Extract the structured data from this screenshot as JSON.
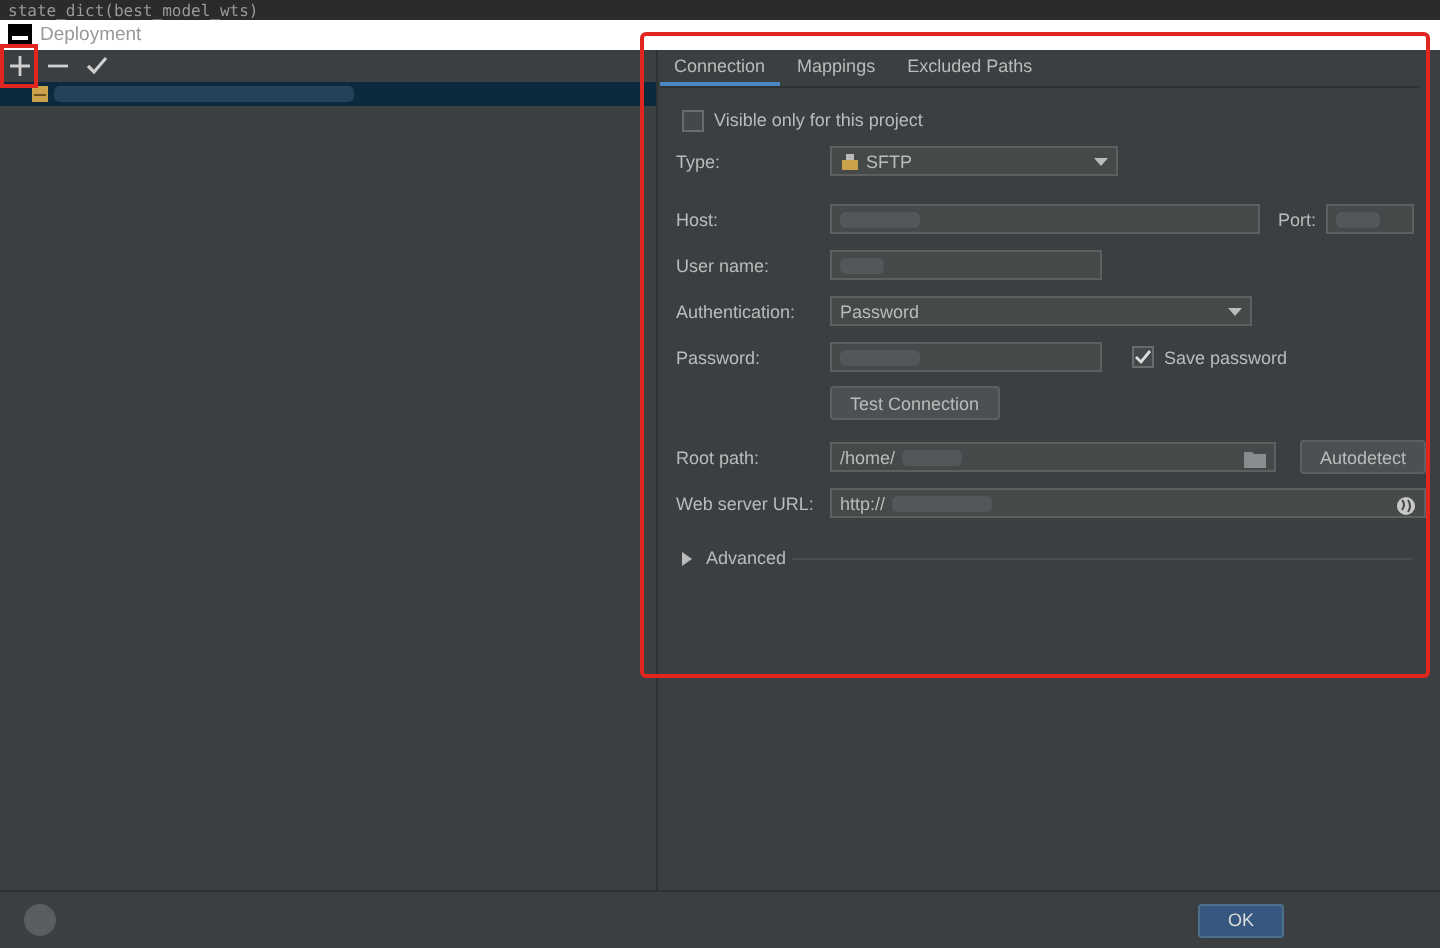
{
  "background_code": "state_dict(best_model_wts)",
  "window": {
    "title": "Deployment"
  },
  "toolbar": [
    {
      "kind": "plus"
    },
    {
      "kind": "minus"
    },
    {
      "kind": "check"
    }
  ],
  "servers": [
    {
      "selected": true
    }
  ],
  "tabs": [
    {
      "label": "Connection",
      "selected": true
    },
    {
      "label": "Mappings",
      "selected": false
    },
    {
      "label": "Excluded Paths",
      "selected": false
    }
  ],
  "visible_only": {
    "label": "Visible only for this project",
    "checked": false
  },
  "type": {
    "label": "Type:",
    "value": "SFTP"
  },
  "host": {
    "label": "Host:"
  },
  "port": {
    "label": "Port:"
  },
  "user_name": {
    "label": "User name:"
  },
  "authentication": {
    "label": "Authentication:",
    "value": "Password"
  },
  "password": {
    "label": "Password:"
  },
  "save_password": {
    "label": "Save password",
    "checked": true
  },
  "test_button": "Test Connection",
  "root_path": {
    "label": "Root path:",
    "value": "/home/"
  },
  "autodetect": "Autodetect",
  "web_server_url": {
    "label": "Web server URL:",
    "value": "http://"
  },
  "advanced": {
    "label": "Advanced",
    "expanded": false
  },
  "footer": {
    "ok": "OK"
  }
}
